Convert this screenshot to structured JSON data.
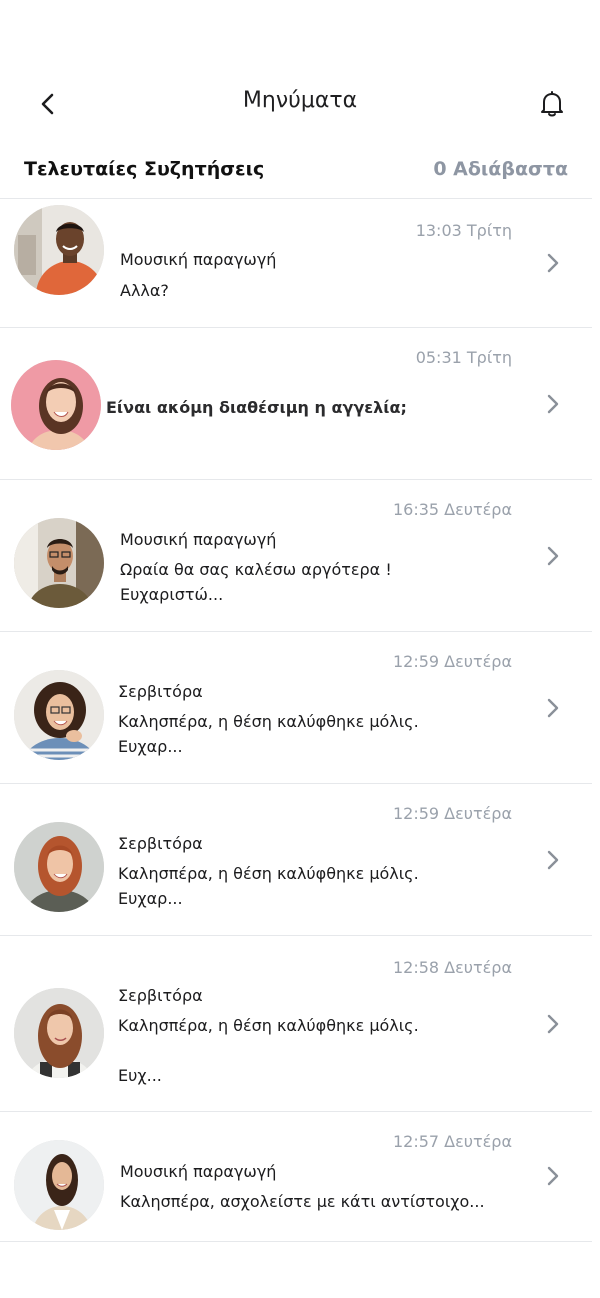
{
  "header": {
    "title": "Μηνύματα",
    "back_icon": "chevron-left-icon",
    "notification_icon": "bell-icon"
  },
  "section": {
    "title": "Τελευταίες Συζητήσεις",
    "unread": "0 Αδιάβαστα"
  },
  "conversations": [
    {
      "time": "13:03 Τρίτη",
      "subject": "Μουσική παραγωγή",
      "preview_1": "Αλλα?",
      "preview_2": "",
      "avatar": "man-orange-shirt"
    },
    {
      "time": "05:31 Τρίτη",
      "subject": "",
      "preview_1": "Είναι ακόμη διαθέσιμη η αγγελία;",
      "preview_2": "",
      "avatar": "woman-pink-background"
    },
    {
      "time": "16:35 Δευτέρα",
      "subject": "Μουσική παραγωγή",
      "preview_1": "Ωραία θα σας καλέσω αργότερα !",
      "preview_2": "Ευχαριστώ...",
      "avatar": "man-glasses"
    },
    {
      "time": "12:59 Δευτέρα",
      "subject": "Σερβιτόρα",
      "preview_1": "Καλησπέρα, η θέση καλύφθηκε μόλις.",
      "preview_2": "Ευχαρ...",
      "avatar": "woman-curly-hair"
    },
    {
      "time": "12:59 Δευτέρα",
      "subject": "Σερβιτόρα",
      "preview_1": "Καλησπέρα, η θέση καλύφθηκε μόλις.",
      "preview_2": "Ευχαρ...",
      "avatar": "woman-red-hair"
    },
    {
      "time": "12:58 Δευτέρα",
      "subject": "Σερβιτόρα",
      "preview_1": "Καλησπέρα, η θέση καλύφθηκε μόλις.",
      "preview_2": "Ευχ...",
      "avatar": "woman-long-hair"
    },
    {
      "time": "12:57 Δευτέρα",
      "subject": "Μουσική παραγωγή",
      "preview_1": "Καλησπέρα, ασχολείστε με κάτι αντίστοιχο...",
      "preview_2": "",
      "avatar": "woman-blazer"
    }
  ]
}
